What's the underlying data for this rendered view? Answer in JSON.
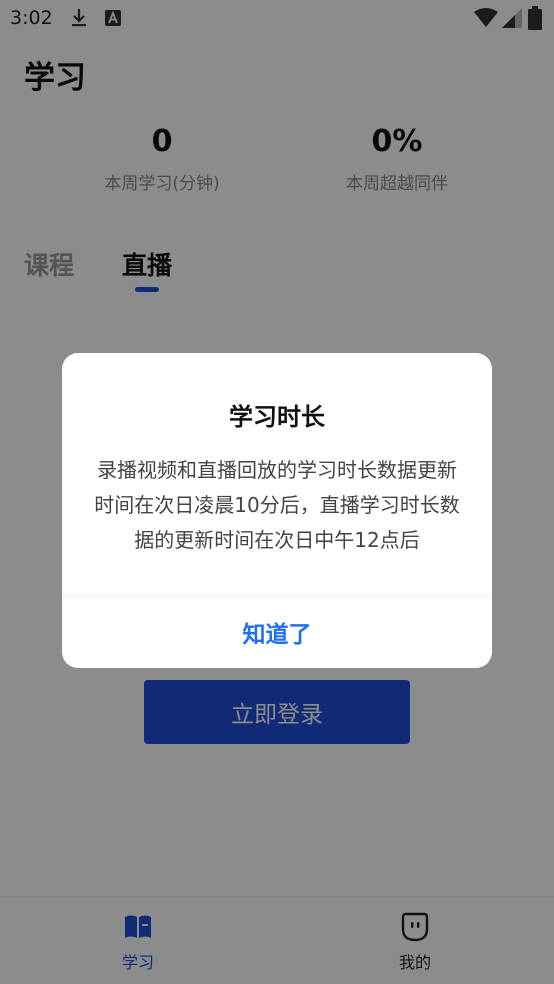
{
  "status_bar": {
    "time": "3:02",
    "icons": [
      "download-icon",
      "a-box-icon",
      "wifi-icon",
      "signal-icon",
      "battery-icon"
    ]
  },
  "header": {
    "title": "学习"
  },
  "stats": [
    {
      "value": "0",
      "label": "本周学习(分钟)"
    },
    {
      "value": "0%",
      "label": "本周超越同伴"
    }
  ],
  "tabs": [
    {
      "label": "课程",
      "active": false
    },
    {
      "label": "直播",
      "active": true
    }
  ],
  "login_button": {
    "label": "立即登录"
  },
  "bottom_nav": [
    {
      "label": "学习",
      "icon": "book-icon",
      "active": true
    },
    {
      "label": "我的",
      "icon": "face-icon",
      "active": false
    }
  ],
  "dialog": {
    "title": "学习时长",
    "message": "录播视频和直播回放的学习时长数据更新时间在次日凌晨10分后，直播学习时长数据的更新时间在次日中午12点后",
    "confirm_label": "知道了"
  },
  "colors": {
    "accent": "#1f4fd8",
    "dialog_button": "#1f6ff2",
    "overlay": "rgba(0,0,0,0.45)"
  }
}
